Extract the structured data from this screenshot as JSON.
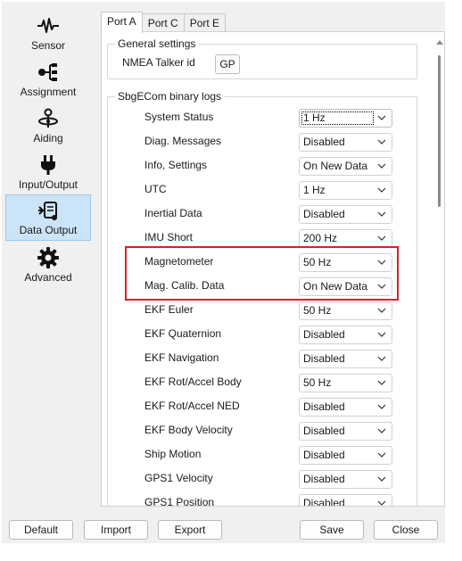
{
  "sidebar": {
    "items": [
      {
        "label": "Sensor",
        "icon": "waveform-icon"
      },
      {
        "label": "Assignment",
        "icon": "hierarchy-icon"
      },
      {
        "label": "Aiding",
        "icon": "satellite-icon"
      },
      {
        "label": "Input/Output",
        "icon": "plug-icon"
      },
      {
        "label": "Data Output",
        "icon": "data-output-icon"
      },
      {
        "label": "Advanced",
        "icon": "gear-icon"
      }
    ],
    "active": "Data Output"
  },
  "tabs": [
    {
      "label": "Port A",
      "active": true
    },
    {
      "label": "Port C",
      "active": false
    },
    {
      "label": "Port E",
      "active": false
    }
  ],
  "general": {
    "title": "General settings",
    "talker_label": "NMEA Talker id",
    "talker_button": "GP"
  },
  "logs": {
    "title": "SbgECom binary logs",
    "rows": [
      {
        "label": "System Status",
        "value": "1 Hz"
      },
      {
        "label": "Diag. Messages",
        "value": "Disabled"
      },
      {
        "label": "Info, Settings",
        "value": "On New Data"
      },
      {
        "label": "UTC",
        "value": "1 Hz"
      },
      {
        "label": "Inertial Data",
        "value": "Disabled"
      },
      {
        "label": "IMU Short",
        "value": "200 Hz"
      },
      {
        "label": "Magnetometer",
        "value": "50 Hz"
      },
      {
        "label": "Mag. Calib. Data",
        "value": "On New Data"
      },
      {
        "label": "EKF Euler",
        "value": "50 Hz"
      },
      {
        "label": "EKF Quaternion",
        "value": "Disabled"
      },
      {
        "label": "EKF Navigation",
        "value": "Disabled"
      },
      {
        "label": "EKF Rot/Accel Body",
        "value": "50 Hz"
      },
      {
        "label": "EKF Rot/Accel NED",
        "value": "Disabled"
      },
      {
        "label": "EKF Body Velocity",
        "value": "Disabled"
      },
      {
        "label": "Ship Motion",
        "value": "Disabled"
      },
      {
        "label": "GPS1 Velocity",
        "value": "Disabled"
      },
      {
        "label": "GPS1 Position",
        "value": "Disabled"
      }
    ]
  },
  "buttons": {
    "default": "Default",
    "import": "Import",
    "export": "Export",
    "save": "Save",
    "close": "Close"
  },
  "colors": {
    "active_nav_bg": "#cce4f7",
    "highlight": "#d9202a"
  }
}
